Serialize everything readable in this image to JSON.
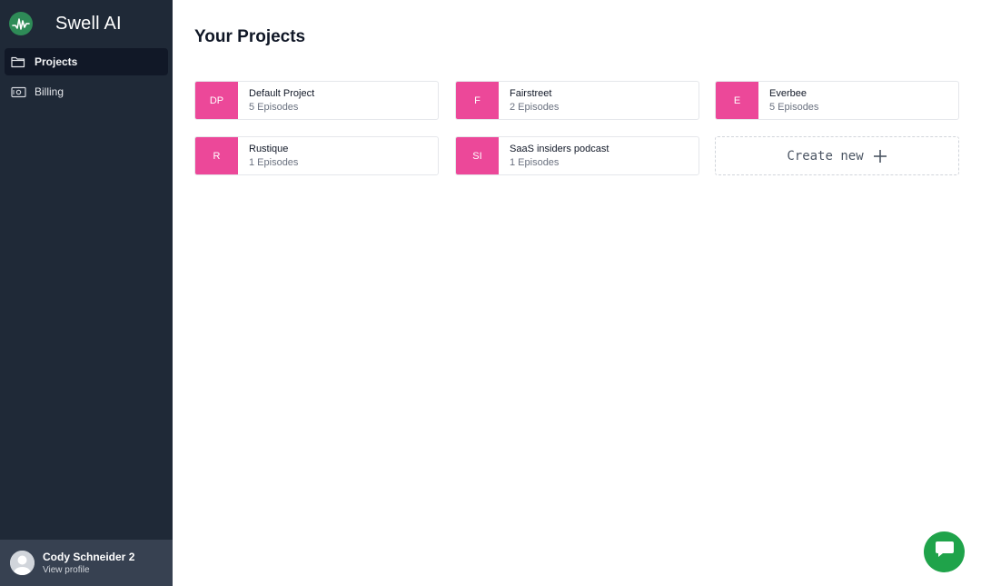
{
  "app": {
    "name": "Swell AI"
  },
  "sidebar": {
    "items": [
      {
        "label": "Projects",
        "icon": "folder-icon",
        "active": true
      },
      {
        "label": "Billing",
        "icon": "money-icon",
        "active": false
      }
    ]
  },
  "profile": {
    "name": "Cody Schneider 2",
    "link": "View profile"
  },
  "main": {
    "title": "Your Projects",
    "projects": [
      {
        "initials": "DP",
        "name": "Default Project",
        "episodes": "5 Episodes"
      },
      {
        "initials": "F",
        "name": "Fairstreet",
        "episodes": "2 Episodes"
      },
      {
        "initials": "E",
        "name": "Everbee",
        "episodes": "5 Episodes"
      },
      {
        "initials": "R",
        "name": "Rustique",
        "episodes": "1 Episodes"
      },
      {
        "initials": "SI",
        "name": "SaaS insiders podcast",
        "episodes": "1 Episodes"
      }
    ],
    "create_label": "Create new"
  },
  "colors": {
    "sidebar_bg": "#1f2937",
    "badge": "#ec4899",
    "chat": "#1fa34a",
    "logo": "#2e8b57"
  }
}
